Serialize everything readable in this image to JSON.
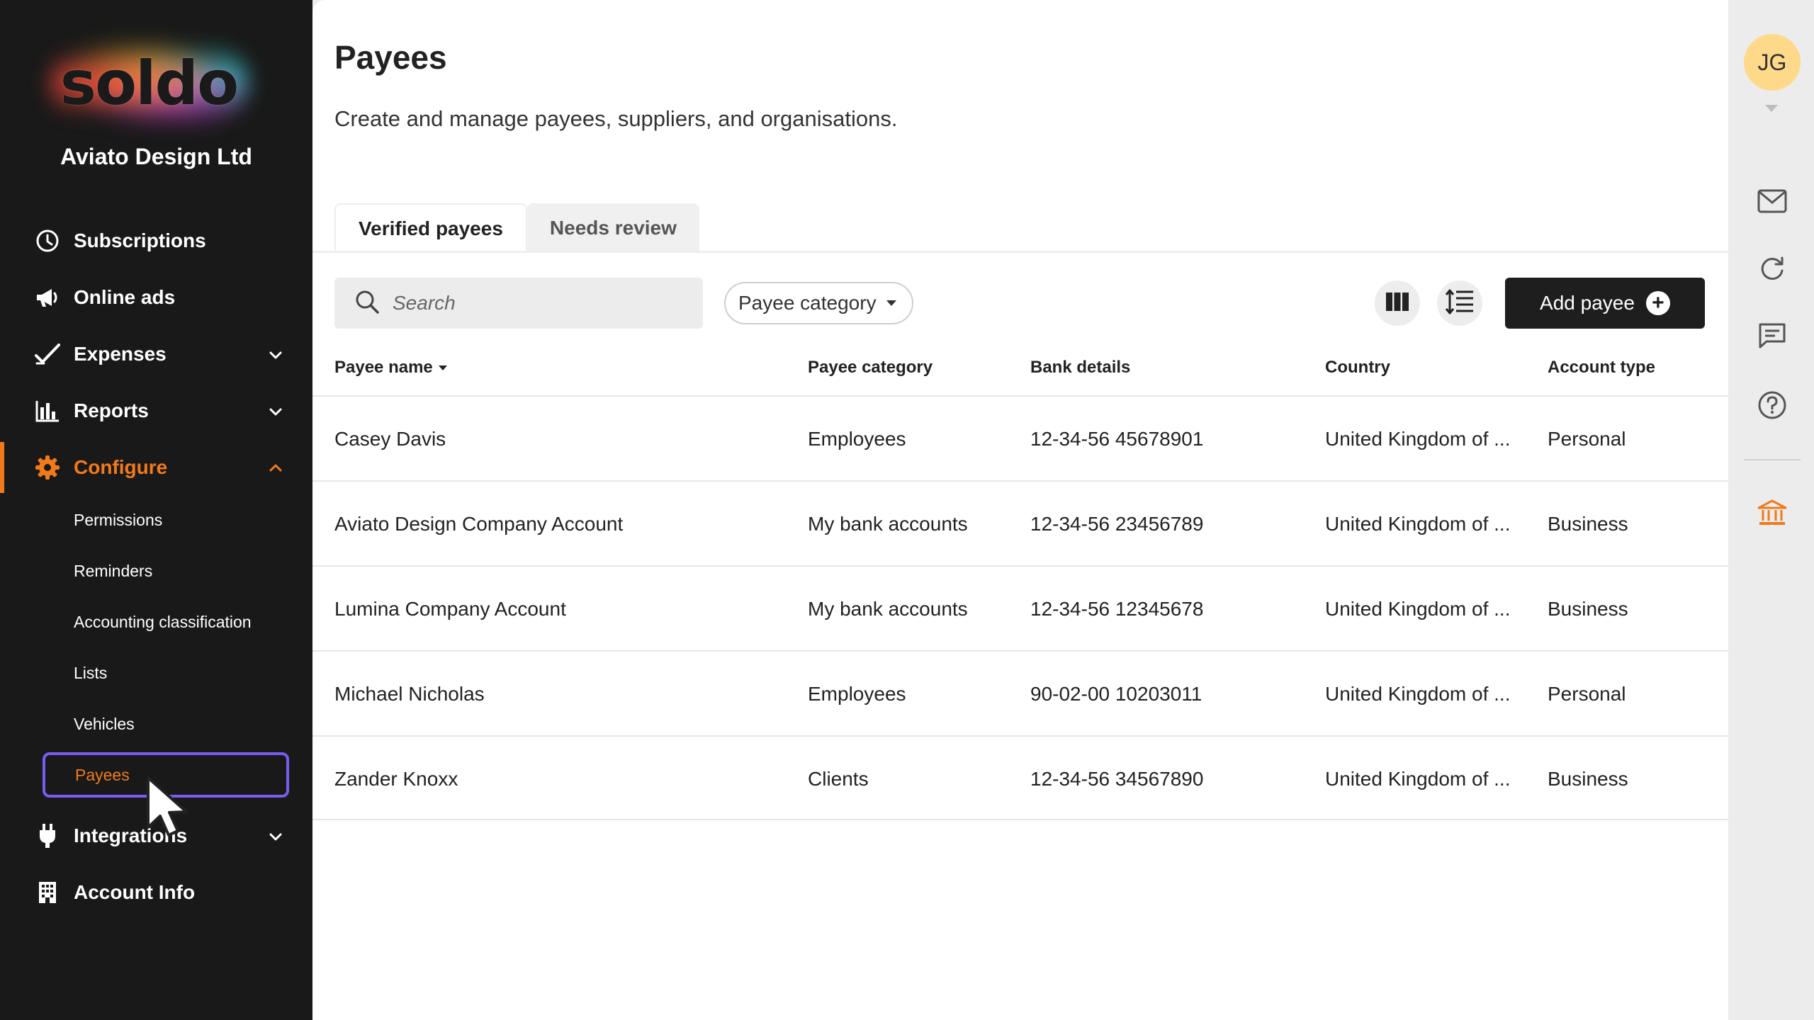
{
  "brand": {
    "logo_text": "soldo",
    "company_name": "Aviato Design Ltd"
  },
  "sidebar": {
    "items": [
      {
        "label": "Subscriptions",
        "icon": "clock-icon"
      },
      {
        "label": "Online ads",
        "icon": "megaphone-icon"
      },
      {
        "label": "Expenses",
        "icon": "checkmark-icon",
        "expandable": true
      },
      {
        "label": "Reports",
        "icon": "bar-chart-icon",
        "expandable": true
      },
      {
        "label": "Configure",
        "icon": "gear-icon",
        "expandable": true,
        "expanded": true,
        "active": true
      },
      {
        "label": "Integrations",
        "icon": "plug-icon",
        "expandable": true
      },
      {
        "label": "Account Info",
        "icon": "building-icon"
      }
    ],
    "configure_subitems": [
      {
        "label": "Permissions"
      },
      {
        "label": "Reminders"
      },
      {
        "label": "Accounting classification"
      },
      {
        "label": "Lists"
      },
      {
        "label": "Vehicles"
      },
      {
        "label": "Payees",
        "selected": true
      }
    ]
  },
  "page": {
    "title": "Payees",
    "subtitle": "Create and manage payees, suppliers, and organisations."
  },
  "tabs": [
    {
      "label": "Verified payees",
      "active": true
    },
    {
      "label": "Needs review",
      "active": false
    }
  ],
  "toolbar": {
    "search_placeholder": "Search",
    "filter_label": "Payee category",
    "add_button_label": "Add payee"
  },
  "table": {
    "columns": [
      "Payee name",
      "Payee category",
      "Bank details",
      "Country",
      "Account type"
    ],
    "rows": [
      [
        "Casey Davis",
        "Employees",
        "12-34-56 45678901",
        "United Kingdom of ...",
        "Personal"
      ],
      [
        "Aviato Design Company Account",
        "My bank accounts",
        "12-34-56 23456789",
        "United Kingdom of ...",
        "Business"
      ],
      [
        "Lumina Company Account",
        "My bank accounts",
        "12-34-56 12345678",
        "United Kingdom of ...",
        "Business"
      ],
      [
        "Michael Nicholas",
        "Employees",
        "90-02-00 10203011",
        "United Kingdom of ...",
        "Personal"
      ],
      [
        "Zander Knoxx",
        "Clients",
        "12-34-56 34567890",
        "United Kingdom of ...",
        "Business"
      ]
    ]
  },
  "user": {
    "initials": "JG"
  },
  "rail_icons": [
    "mail-icon",
    "refresh-icon",
    "chat-icon",
    "help-icon",
    "bank-icon"
  ],
  "colors": {
    "sidebar_bg": "#191919",
    "accent_orange": "#f27a1a",
    "selection_outline": "#7a5cf0",
    "primary_button": "#1e1e1e",
    "avatar_bg": "#ffd98a"
  }
}
